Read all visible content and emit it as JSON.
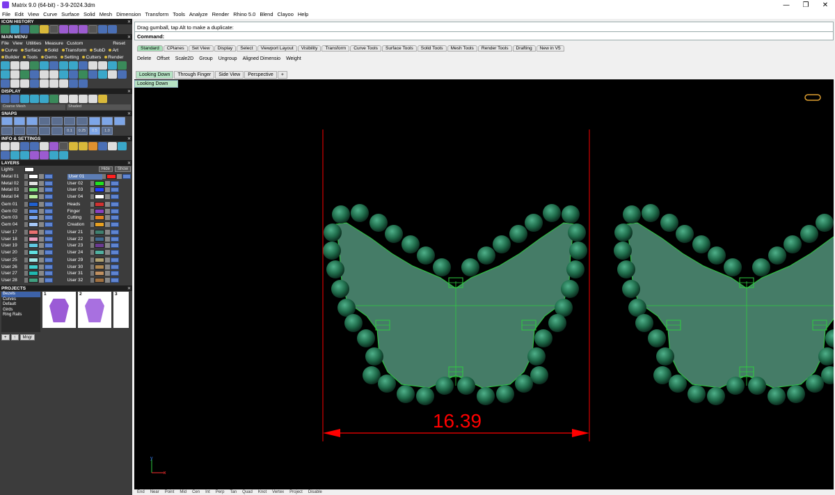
{
  "window": {
    "title": "Matrix 9.0 (64-bit) - 3-9-2024.3dm",
    "minimize": "—",
    "maximize": "❐",
    "close": "✕"
  },
  "menubar": [
    "File",
    "Edit",
    "View",
    "Curve",
    "Surface",
    "Solid",
    "Mesh",
    "Dimension",
    "Transform",
    "Tools",
    "Analyze",
    "Render",
    "Rhino 5.0",
    "Blend",
    "Clayoo",
    "Help"
  ],
  "left_panel": {
    "icon_history": "ICON HISTORY",
    "main_menu": {
      "title": "MAIN MENU",
      "menu_row": [
        "File",
        "View",
        "Utilities",
        "Measure",
        "Custom"
      ],
      "reset": "Reset",
      "row1": [
        "Curve",
        "Surface",
        "Solid",
        "Transform",
        "SubD",
        "Art"
      ],
      "row2": [
        "Builder",
        "Tools",
        "Gems",
        "Setting",
        "Cutters",
        "Render"
      ]
    },
    "display": {
      "title": "DISPLAY",
      "mesh_select": "Coarse Mesh",
      "shade_select": "Shaded"
    },
    "snaps": {
      "title": "SNAPS",
      "values": [
        "0.1",
        "0.25",
        "0.5",
        "1.0"
      ]
    },
    "info": {
      "title": "INFO & SETTINGS"
    },
    "layers": {
      "title": "LAYERS",
      "lights": "Lights",
      "hide": "Hide",
      "show": "Show",
      "groups": [
        {
          "left": [
            [
              "Metal 01",
              "#ffffff"
            ],
            [
              "Metal 02",
              "#e0e0e0"
            ],
            [
              "Metal 03",
              "#7be87b"
            ],
            [
              "Metal 04",
              "#b8f0a0"
            ]
          ],
          "right": [
            [
              "User 01",
              "#ff2020"
            ],
            [
              "User 02",
              "#20e020"
            ],
            [
              "User 03",
              "#2040ff"
            ],
            [
              "User 04",
              "#ffffff"
            ]
          ]
        },
        {
          "left": [
            [
              "Gem 01",
              "#2060d0"
            ],
            [
              "Gem 02",
              "#5b8ee8"
            ],
            [
              "Gem 03",
              "#7aa6f0"
            ],
            [
              "Gem 04",
              "#a6c8f8"
            ]
          ],
          "right": [
            [
              "Heads",
              "#d03030"
            ],
            [
              "Finger",
              "#8a40c0"
            ],
            [
              "Cutting",
              "#e08020"
            ],
            [
              "Creation",
              "#e8a020"
            ]
          ]
        },
        {
          "left": [
            [
              "User 17",
              "#e87070"
            ],
            [
              "User 18",
              "#f0a0c0"
            ],
            [
              "User 19",
              "#60c8e0"
            ],
            [
              "User 20",
              "#60e0e0"
            ]
          ],
          "right": [
            [
              "User 21",
              "#408070"
            ],
            [
              "User 22",
              "#406a90"
            ],
            [
              "User 23",
              "#6a3a90"
            ],
            [
              "User 24",
              "#50b0a0"
            ]
          ]
        },
        {
          "left": [
            [
              "User 25",
              "#a0e8e8"
            ],
            [
              "User 26",
              "#40d0d0"
            ],
            [
              "User 27",
              "#20b8b0"
            ],
            [
              "User 28",
              "#40a080"
            ]
          ],
          "right": [
            [
              "User 29",
              "#b0a070"
            ],
            [
              "User 30",
              "#b08850"
            ],
            [
              "User 31",
              "#c09060"
            ],
            [
              "User 32",
              "#a07040"
            ]
          ]
        }
      ]
    },
    "projects": {
      "title": "PROJECTS",
      "list": [
        "Bezels",
        "Curves",
        "Default",
        "Girds",
        "Ring Rails"
      ],
      "thumbs": [
        "1",
        "2",
        "3"
      ],
      "buttons": [
        "+",
        "↑",
        "Mngr"
      ]
    }
  },
  "command": {
    "history": "Drag gumball, tap Alt to make a duplicate:",
    "prompt": "Command:"
  },
  "toolbar_tabs": [
    "Standard",
    "CPlanes",
    "Set View",
    "Display",
    "Select",
    "Viewport Layout",
    "Visibility",
    "Transform",
    "Curve Tools",
    "Surface Tools",
    "Solid Tools",
    "Mesh Tools",
    "Render Tools",
    "Drafting",
    "New in V5"
  ],
  "toolbar_items": [
    "Delete",
    "Offset",
    "Scale2D",
    "Group",
    "Ungroup",
    "Aligned Dimensio",
    "Weight"
  ],
  "view_tabs": [
    "Looking Down",
    "Through Finger",
    "Side View",
    "Perspective",
    "+"
  ],
  "viewport": {
    "label": "Looking Down",
    "dimension": "16.39",
    "axis_y": "y",
    "axis_x": "x"
  },
  "status_items": [
    "End",
    "Near",
    "Point",
    "Mid",
    "Cen",
    "Int",
    "Perp",
    "Tan",
    "Quad",
    "Knot",
    "Vertex",
    "Project",
    "Disable"
  ],
  "colors": {
    "gem": "#1f6b4a",
    "shape_fill": "#5ca58a",
    "shape_stroke": "#2ecc40",
    "dimension": "#ff0000",
    "viewport_bg": "#000000"
  }
}
